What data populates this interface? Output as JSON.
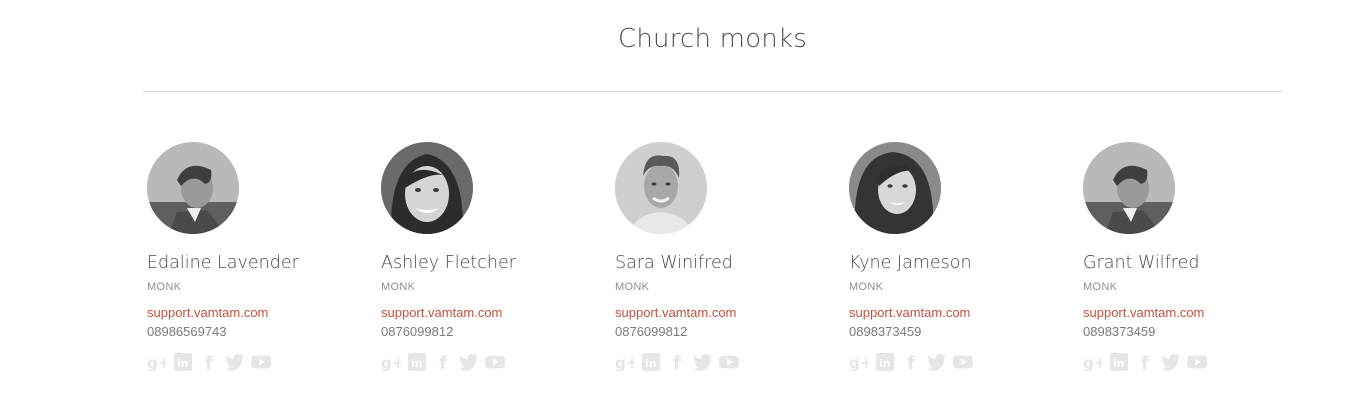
{
  "section": {
    "title": "Church monks"
  },
  "members": [
    {
      "name": "Edaline Lavender",
      "role": "MONK",
      "email": "support.vamtam.com",
      "phone": "08986569743",
      "photo": "boy-looking-down"
    },
    {
      "name": "Ashley Fletcher",
      "role": "MONK",
      "email": "support.vamtam.com",
      "phone": "0876099812",
      "photo": "smiling-woman"
    },
    {
      "name": "Sara Winifred",
      "role": "MONK",
      "email": "support.vamtam.com",
      "phone": "0876099812",
      "photo": "smiling-man"
    },
    {
      "name": "Kyne Jameson",
      "role": "MONK",
      "email": "support.vamtam.com",
      "phone": "0898373459",
      "photo": "smiling-girl"
    },
    {
      "name": "Grant Wilfred",
      "role": "MONK",
      "email": "support.vamtam.com",
      "phone": "0898373459",
      "photo": "boy-looking-down"
    }
  ],
  "social_icons": [
    "google-plus-icon",
    "linkedin-icon",
    "facebook-icon",
    "twitter-icon",
    "youtube-icon"
  ],
  "colors": {
    "email": "#c0533f",
    "icon": "#e6e6e6",
    "divider": "#dcdcdc"
  }
}
